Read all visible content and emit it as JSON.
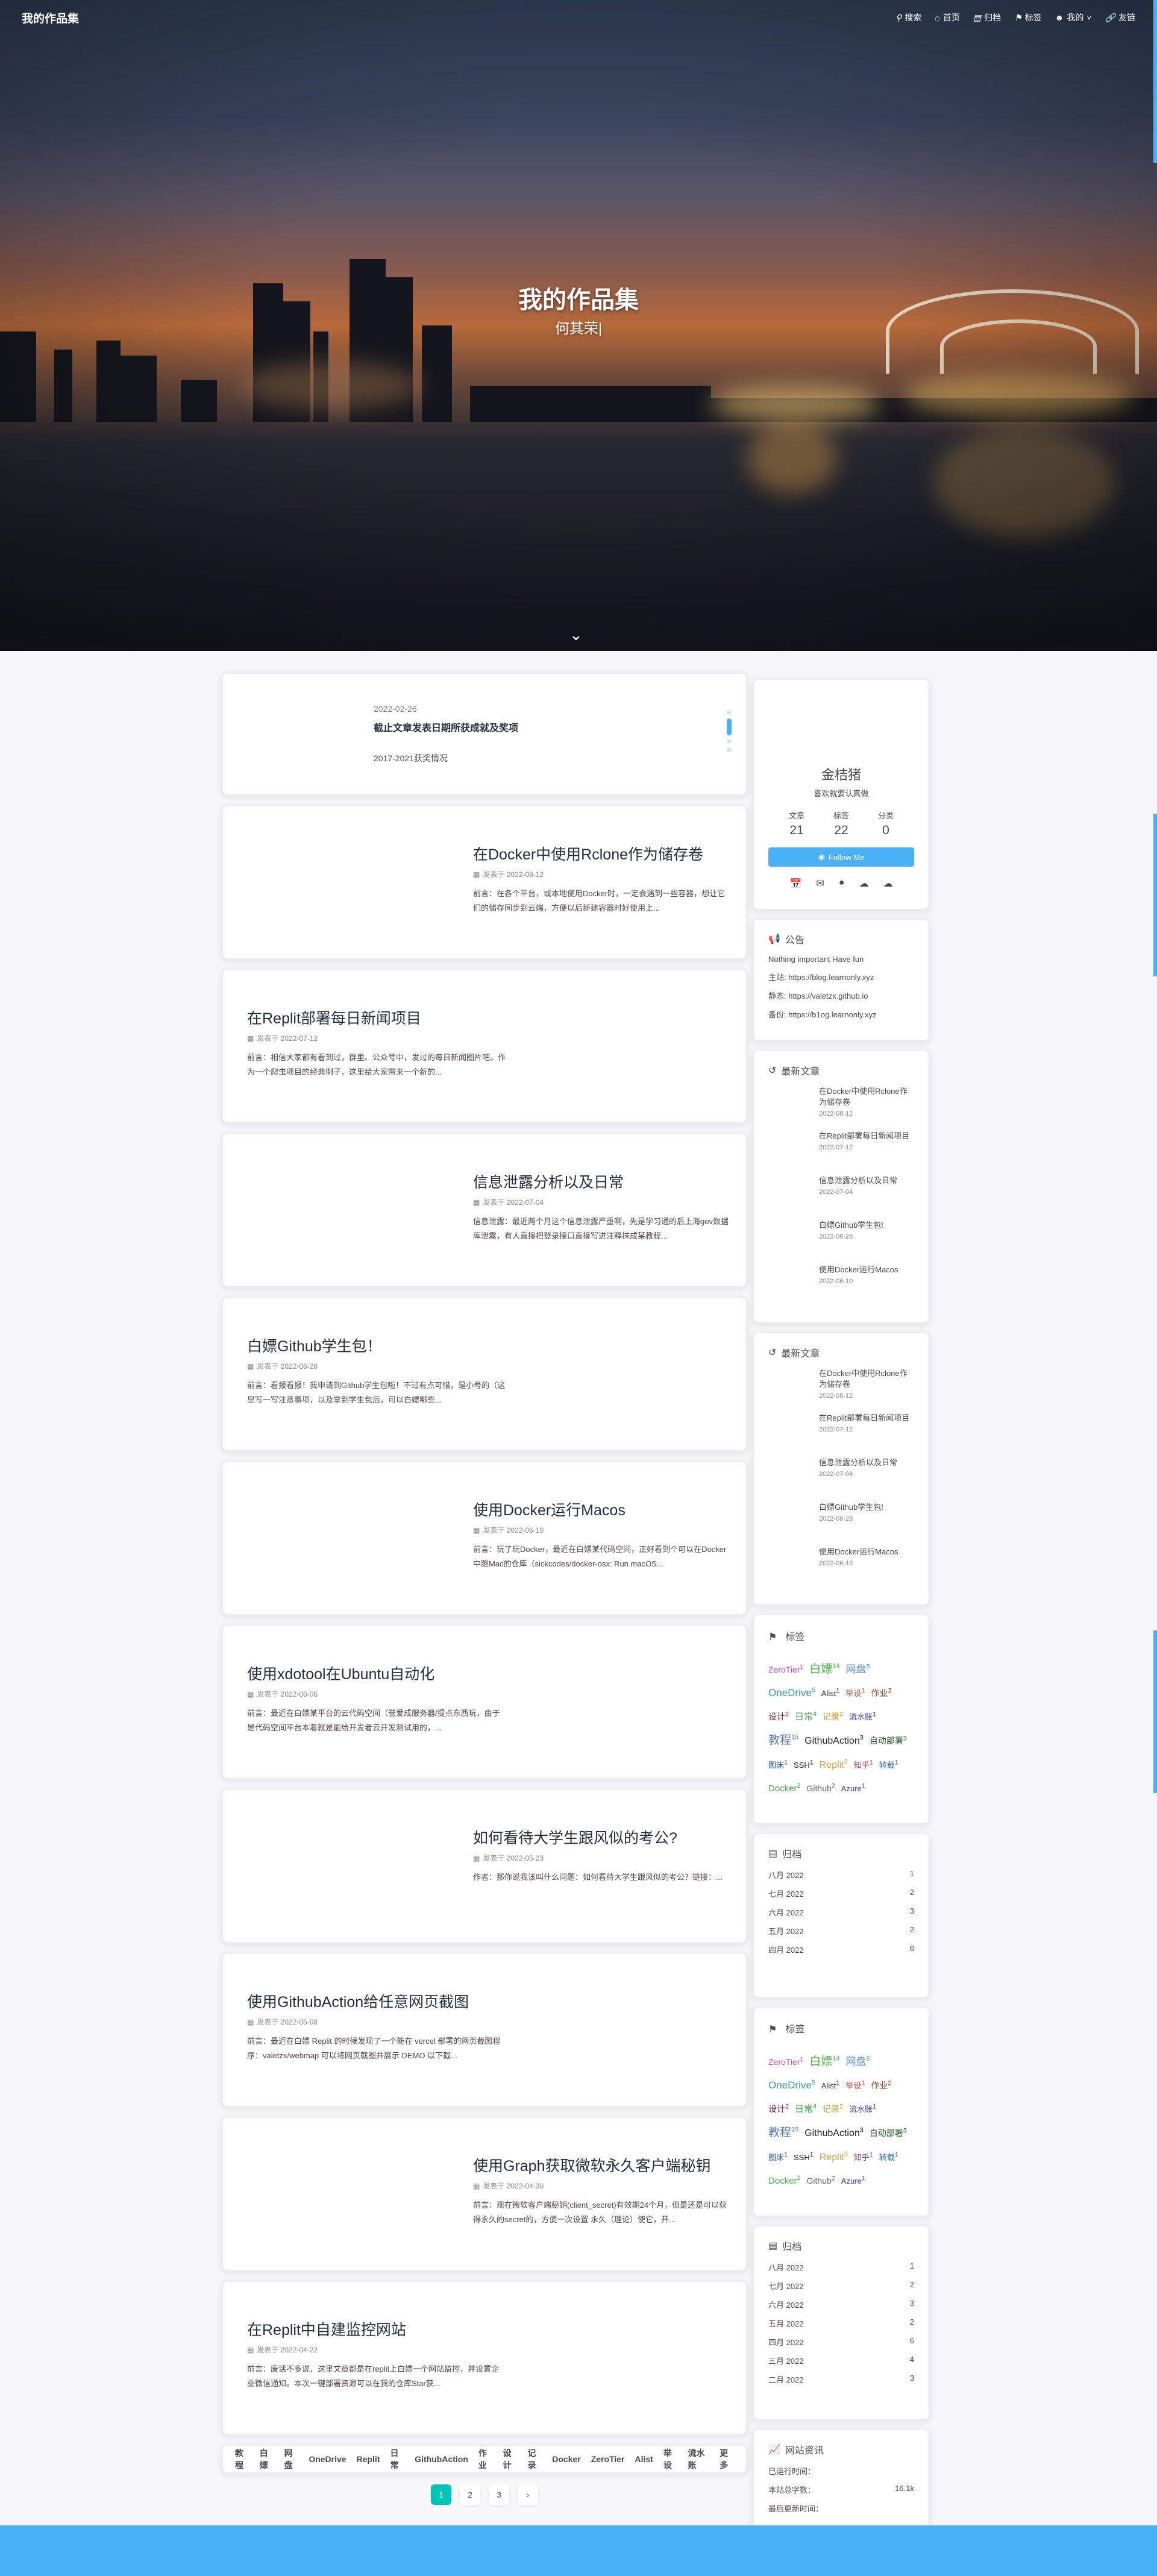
{
  "nav": {
    "brand": "我的作品集",
    "items": [
      {
        "icon": "search-icon",
        "label": "搜索"
      },
      {
        "icon": "home-icon",
        "label": "首页"
      },
      {
        "icon": "archive-icon",
        "label": "归档"
      },
      {
        "icon": "tag-icon",
        "label": "标签"
      },
      {
        "icon": "user-icon",
        "label": "我的"
      },
      {
        "icon": "link-icon",
        "label": "友链"
      }
    ]
  },
  "hero": {
    "title": "我的作品集",
    "subtitle": "何其荣|"
  },
  "slider": {
    "date": "2022-02-26",
    "title": "截止文章发表日期所获成就及奖项",
    "desc": "2017-2021获奖情况"
  },
  "posts": [
    {
      "title": "在Docker中使用Rclone作为储存卷",
      "meta": "发表于 2022-08-12",
      "excerpt": "前言：在各个平台，或本地使用Docker时，一定会遇到一些容器，想让它们的储存同步到云端，方便以后新建容器时好使用上..."
    },
    {
      "title": "在Replit部署每日新闻项目",
      "meta": "发表于 2022-07-12",
      "excerpt": "前言：相信大家都有看到过，群里、公众号中，发过的每日新闻图片吧。作为一个爬虫项目的经典例子，这里给大家带来一个新的..."
    },
    {
      "title": "信息泄露分析以及日常",
      "meta": "发表于 2022-07-04",
      "excerpt": "信息泄露：最近两个月这个信息泄露严重啊，先是学习通的后上海gov数据库泄露，有人直接把登录接口直接写进注释抹成某教程..."
    },
    {
      "title": "白嫖Github学生包！",
      "meta": "发表于 2022-06-28",
      "excerpt": "前言：看报看报！我申请到Github学生包啦！不过有点可惜，是小号的（这里写一写注意事项，以及拿到学生包后，可以白嫖哪些..."
    },
    {
      "title": "使用Docker运行Macos",
      "meta": "发表于 2022-06-10",
      "excerpt": "前言：玩了玩Docker，最近在白嫖某代码空间，正好看到个可以在Docker中跑Mac的仓库（sickcodes/docker-osx: Run macOS..."
    },
    {
      "title": "使用xdotool在Ubuntu自动化",
      "meta": "发表于 2022-06-06",
      "excerpt": "前言：最近在白嫖某平台的云代码空间（誉爱成服务器/提点东西玩，由于是代码空间平台本着就是能给开发者云开发测试用的，..."
    },
    {
      "title": "如何看待大学生跟风似的考公?",
      "meta": "发表于 2022-05-23",
      "excerpt": "作者：那你说我该叫什么问题：如何看待大学生跟风似的考公？链接：..."
    },
    {
      "title": "使用GithubAction给任意网页截图",
      "meta": "发表于 2022-05-08",
      "excerpt": "前言：最近在白嫖 Replit 的时候发现了一个能在 vercel 部署的网页截图程序：valetzx/webmap 可以将网页截图并展示 DEMO 以下截..."
    },
    {
      "title": "使用Graph获取微软永久客户端秘钥",
      "meta": "发表于 2022-04-30",
      "excerpt": "前言：现在微软客户端秘钥(client_secret)有效期24个月，但是还是可以获得永久的secret的，方便一次设置 永久（理论）使它，开..."
    },
    {
      "title": "在Replit中自建监控网站",
      "meta": "发表于 2022-04-22",
      "excerpt": "前言：废话不多说，这里文章都是在replit上白嫖一个网站监控，并设置企业微信通知。本次一键部署资源可以在我的仓库Star获..."
    }
  ],
  "tagbar": [
    "教程",
    "白嫖",
    "网盘",
    "OneDrive",
    "Replit",
    "日常",
    "GithubAction",
    "作业",
    "设计",
    "记录",
    "Docker",
    "ZeroTier",
    "Alist",
    "举设",
    "流水账",
    "更多"
  ],
  "pager": [
    "1",
    "2",
    "3",
    "›"
  ],
  "author": {
    "name": "金桔猪",
    "desc": "喜欢就要认真做",
    "stats": [
      {
        "label": "文章",
        "value": "21"
      },
      {
        "label": "标签",
        "value": "22"
      },
      {
        "label": "分类",
        "value": "0"
      }
    ],
    "follow": "Follow Me"
  },
  "announce": {
    "title": "公告",
    "lines": [
      "Nothing important Have fun",
      "主站: https://blog.learnonly.xyz",
      "静态: https://valetzx.github.io",
      "备份: https://b1og.learnonly.xyz"
    ]
  },
  "recent": {
    "title": "最新文章",
    "items": [
      {
        "title": "在Docker中使用Rclone作为储存卷",
        "date": "2022-08-12"
      },
      {
        "title": "在Replit部署每日新闻项目",
        "date": "2022-07-12"
      },
      {
        "title": "信息泄露分析以及日常",
        "date": "2022-07-04"
      },
      {
        "title": "白嫖Github学生包!",
        "date": "2022-06-28"
      },
      {
        "title": "使用Docker运行Macos",
        "date": "2022-06-10"
      }
    ]
  },
  "tags": {
    "title": "标签",
    "items": [
      {
        "name": "ZeroTier",
        "count": "1",
        "color": "#c04eb8",
        "size": "14"
      },
      {
        "name": "白嫖",
        "count": "14",
        "color": "#4eb848",
        "size": "19"
      },
      {
        "name": "网盘",
        "count": "5",
        "color": "#5a8fd6",
        "size": "17"
      },
      {
        "name": "OneDrive",
        "count": "5",
        "color": "#3b9a9a",
        "size": "17"
      },
      {
        "name": "Alist",
        "count": "1",
        "color": "#333333",
        "size": "13"
      },
      {
        "name": "举设",
        "count": "1",
        "color": "#c0504d",
        "size": "13"
      },
      {
        "name": "作业",
        "count": "2",
        "color": "#8b3a1a",
        "size": "14"
      },
      {
        "name": "设计",
        "count": "2",
        "color": "#7a1a4a",
        "size": "14"
      },
      {
        "name": "日常",
        "count": "4",
        "color": "#44aa44",
        "size": "15"
      },
      {
        "name": "记录",
        "count": "2",
        "color": "#c9a227",
        "size": "14"
      },
      {
        "name": "流水账",
        "count": "1",
        "color": "#4a3aaa",
        "size": "13"
      },
      {
        "name": "教程",
        "count": "15",
        "color": "#5a7ab8",
        "size": "19"
      },
      {
        "name": "GithubAction",
        "count": "3",
        "color": "#222222",
        "size": "16"
      },
      {
        "name": "自动部署",
        "count": "3",
        "color": "#225522",
        "size": "14"
      },
      {
        "name": "图床",
        "count": "1",
        "color": "#2255aa",
        "size": "13"
      },
      {
        "name": "SSH",
        "count": "1",
        "color": "#222222",
        "size": "13"
      },
      {
        "name": "Replit",
        "count": "5",
        "color": "#d4a14a",
        "size": "16"
      },
      {
        "name": "知乎",
        "count": "1",
        "color": "#aa3a6a",
        "size": "13"
      },
      {
        "name": "转载",
        "count": "1",
        "color": "#2a6aaa",
        "size": "13"
      },
      {
        "name": "Docker",
        "count": "2",
        "color": "#4aaa4a",
        "size": "15"
      },
      {
        "name": "Github",
        "count": "2",
        "color": "#666666",
        "size": "14"
      },
      {
        "name": "Azure",
        "count": "1",
        "color": "#3a3aaa",
        "size": "13"
      }
    ]
  },
  "archive": {
    "title": "归档",
    "rows": [
      {
        "m": "八月 2022",
        "n": "1"
      },
      {
        "m": "七月 2022",
        "n": "2"
      },
      {
        "m": "六月 2022",
        "n": "3"
      },
      {
        "m": "五月 2022",
        "n": "2"
      },
      {
        "m": "四月 2022",
        "n": "6"
      },
      {
        "m": "三月 2022",
        "n": "4"
      },
      {
        "m": "二月 2022",
        "n": "3"
      }
    ]
  },
  "webinfo": {
    "title": "网站资讯",
    "rows": [
      {
        "k": "已运行时间：",
        "v": ""
      },
      {
        "k": "本站总字数：",
        "v": "16.1k"
      },
      {
        "k": "最后更新时间：",
        "v": ""
      }
    ]
  },
  "colors": {
    "accent": "#49b1f5",
    "active_page": "#00c4b6"
  }
}
